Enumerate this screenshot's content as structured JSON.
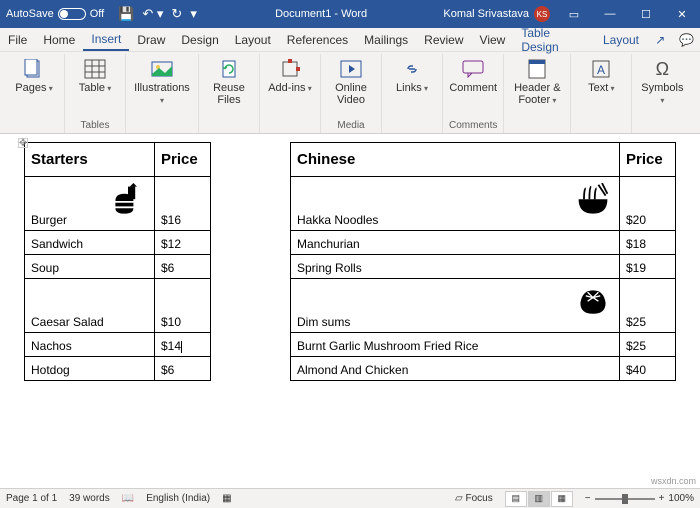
{
  "titlebar": {
    "autosave_label": "AutoSave",
    "autosave_state": "Off",
    "title": "Document1 - Word",
    "user_name": "Komal Srivastava",
    "user_initials": "KS"
  },
  "tabs": {
    "file": "File",
    "home": "Home",
    "insert": "Insert",
    "draw": "Draw",
    "design": "Design",
    "layout": "Layout",
    "references": "References",
    "mailings": "Mailings",
    "review": "Review",
    "view": "View",
    "table_design": "Table Design",
    "layout2": "Layout"
  },
  "ribbon": {
    "pages": "Pages",
    "table": "Table",
    "tables_grp": "Tables",
    "illustrations": "Illustrations",
    "reuse_files": "Reuse Files",
    "addins": "Add-ins",
    "online_video": "Online Video",
    "media_grp": "Media",
    "links": "Links",
    "comment": "Comment",
    "comments_grp": "Comments",
    "header_footer": "Header & Footer",
    "text": "Text",
    "symbols": "Symbols"
  },
  "table": {
    "h1": "Starters",
    "h2": "Price",
    "h3": "Chinese",
    "h4": "Price",
    "rows": [
      {
        "a": "Burger",
        "ap": "$16",
        "b": "Hakka Noodles",
        "bp": "$20"
      },
      {
        "a": "Sandwich",
        "ap": "$12",
        "b": "Manchurian",
        "bp": "$18"
      },
      {
        "a": "Soup",
        "ap": "$6",
        "b": "Spring Rolls",
        "bp": "$19"
      },
      {
        "a": "Caesar Salad",
        "ap": "$10",
        "b": "Dim sums",
        "bp": "$25"
      },
      {
        "a": "Nachos",
        "ap": "$14",
        "b": "Burnt Garlic Mushroom Fried Rice",
        "bp": "$25"
      },
      {
        "a": "Hotdog",
        "ap": "$6",
        "b": "Almond And Chicken",
        "bp": "$40"
      }
    ]
  },
  "statusbar": {
    "page": "Page 1 of 1",
    "words": "39 words",
    "lang": "English (India)",
    "focus": "Focus",
    "zoom": "100%"
  },
  "watermark": "wsxdn.com"
}
